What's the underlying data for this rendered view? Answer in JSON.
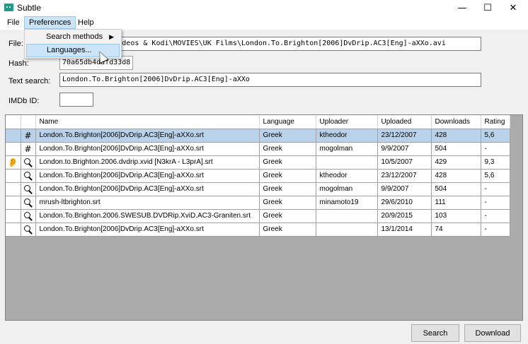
{
  "window": {
    "title": "Subtle",
    "min_glyph": "—",
    "max_glyph": "☐",
    "close_glyph": "✕"
  },
  "menubar": {
    "file": "File",
    "preferences": "Preferences",
    "help": "Help"
  },
  "dropdown": {
    "search_methods": "Search methods",
    "arrow": "▶",
    "languages": "Languages..."
  },
  "form": {
    "file_label": "File:",
    "file_value": "P FROM E\\My Videos & Kodi\\MOVIES\\UK Films\\London.To.Brighton[2006]DvDrip.AC3[Eng]-aXXo.avi",
    "hash_label": "Hash:",
    "hash_value": "70a65db4dafd33d8",
    "text_label": "Text search:",
    "text_value": "London.To.Brighton[2006]DvDrip.AC3[Eng]-aXXo",
    "imdb_label": "IMDb ID:",
    "imdb_value": ""
  },
  "grid": {
    "columns": [
      "",
      "",
      "Name",
      "Language",
      "Uploader",
      "Uploaded",
      "Downloads",
      "Rating"
    ],
    "rows": [
      {
        "c1": "",
        "c2": "#",
        "name": "London.To.Brighton[2006]DvDrip.AC3[Eng]-aXXo.srt",
        "language": "Greek",
        "uploader": "ktheodor",
        "uploaded": "23/12/2007",
        "downloads": "428",
        "rating": "5,6",
        "selected": true
      },
      {
        "c1": "",
        "c2": "#",
        "name": "London.To.Brighton[2006]DvDrip.AC3[Eng]-aXXo.srt",
        "language": "Greek",
        "uploader": "mogolman",
        "uploaded": "9/9/2007",
        "downloads": "504",
        "rating": "-"
      },
      {
        "c1": "ear",
        "c2": "search",
        "name": "London.to.Brighton.2006.dvdrip.xvid [N3krA - L3prA].srt",
        "language": "Greek",
        "uploader": "",
        "uploaded": "10/5/2007",
        "downloads": "429",
        "rating": "9,3"
      },
      {
        "c1": "",
        "c2": "search",
        "name": "London.To.Brighton[2006]DvDrip.AC3[Eng]-aXXo.srt",
        "language": "Greek",
        "uploader": "ktheodor",
        "uploaded": "23/12/2007",
        "downloads": "428",
        "rating": "5,6"
      },
      {
        "c1": "",
        "c2": "search",
        "name": "London.To.Brighton[2006]DvDrip.AC3[Eng]-aXXo.srt",
        "language": "Greek",
        "uploader": "mogolman",
        "uploaded": "9/9/2007",
        "downloads": "504",
        "rating": "-"
      },
      {
        "c1": "",
        "c2": "search",
        "name": "mrush-ltbrighton.srt",
        "language": "Greek",
        "uploader": "minamoto19",
        "uploaded": "29/6/2010",
        "downloads": "111",
        "rating": "-"
      },
      {
        "c1": "",
        "c2": "search",
        "name": "London.To.Brighton.2006.SWESUB.DVDRip.XviD.AC3-Graniten.srt",
        "language": "Greek",
        "uploader": "",
        "uploaded": "20/9/2015",
        "downloads": "103",
        "rating": "-"
      },
      {
        "c1": "",
        "c2": "search",
        "name": "London.To.Brighton[2006]DvDrip.AC3[Eng]-aXXo.srt",
        "language": "Greek",
        "uploader": "",
        "uploaded": "13/1/2014",
        "downloads": "74",
        "rating": "-"
      }
    ]
  },
  "buttons": {
    "search": "Search",
    "download": "Download"
  },
  "colors": {
    "selection": "#bad1ea",
    "menu_highlight": "#cce4f7"
  }
}
